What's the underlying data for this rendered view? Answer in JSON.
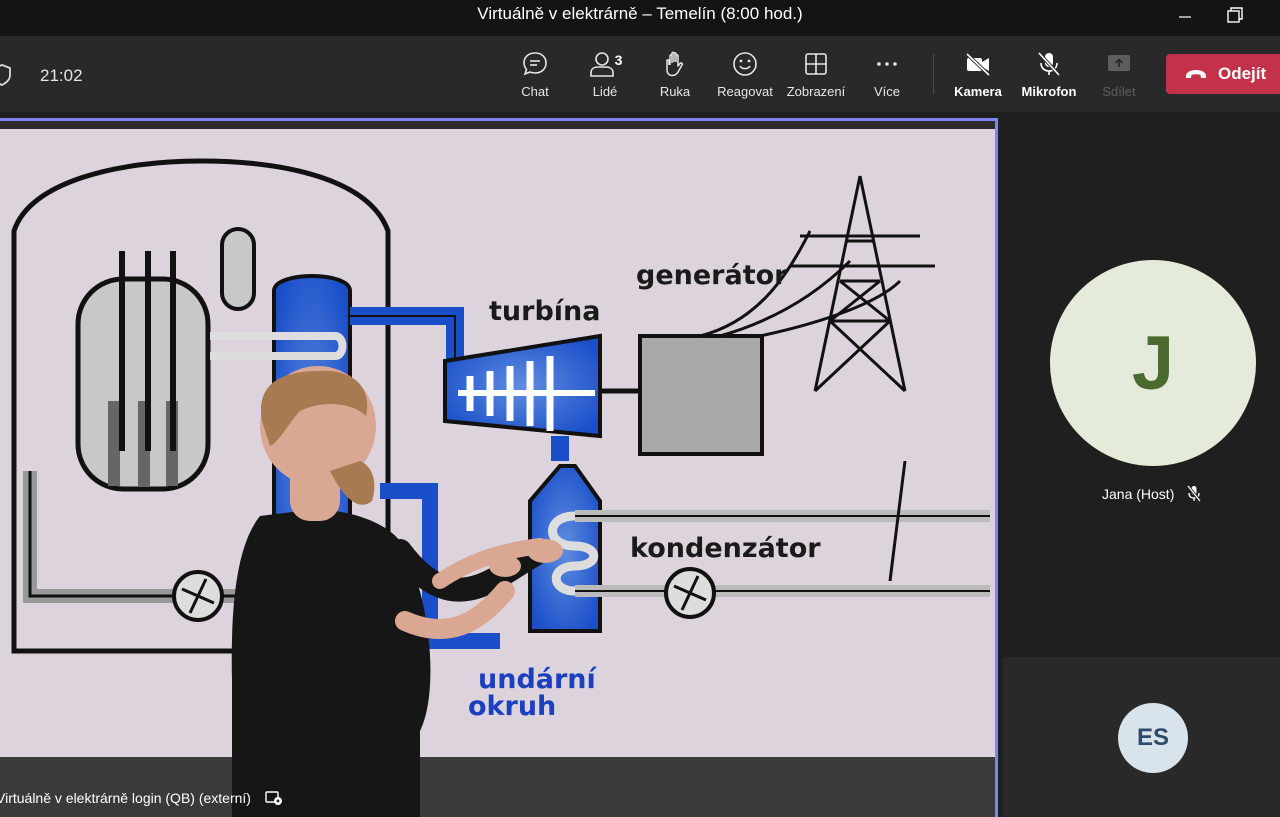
{
  "window": {
    "title": "Virtuálně v elektrárně – Temelín (8:00 hod.)"
  },
  "toolbar": {
    "timer": "21:02",
    "buttons": {
      "chat": "Chat",
      "people": "Lidé",
      "people_count": "3",
      "raise_hand": "Ruka",
      "react": "Reagovat",
      "view": "Zobrazení",
      "more": "Více",
      "camera": "Kamera",
      "mic": "Mikrofon",
      "share": "Sdílet"
    },
    "leave_label": "Odejít",
    "leave_color": "#c4314b"
  },
  "stage": {
    "caption": "Virtuálně v elektrárně login (QB) (externí)",
    "diagram_labels": {
      "generator": "generátor",
      "turbine": "turbína",
      "condenser": "kondenzátor",
      "secondary_1": "undární",
      "secondary_2": "okruh"
    },
    "highlight_color": "#7f85f5"
  },
  "participants": [
    {
      "initials": "J",
      "name": "Jana (Host)",
      "muted": true,
      "avatar_color": "#e5ebdb"
    },
    {
      "initials": "ES",
      "avatar_color": "#d9e3ec"
    }
  ]
}
